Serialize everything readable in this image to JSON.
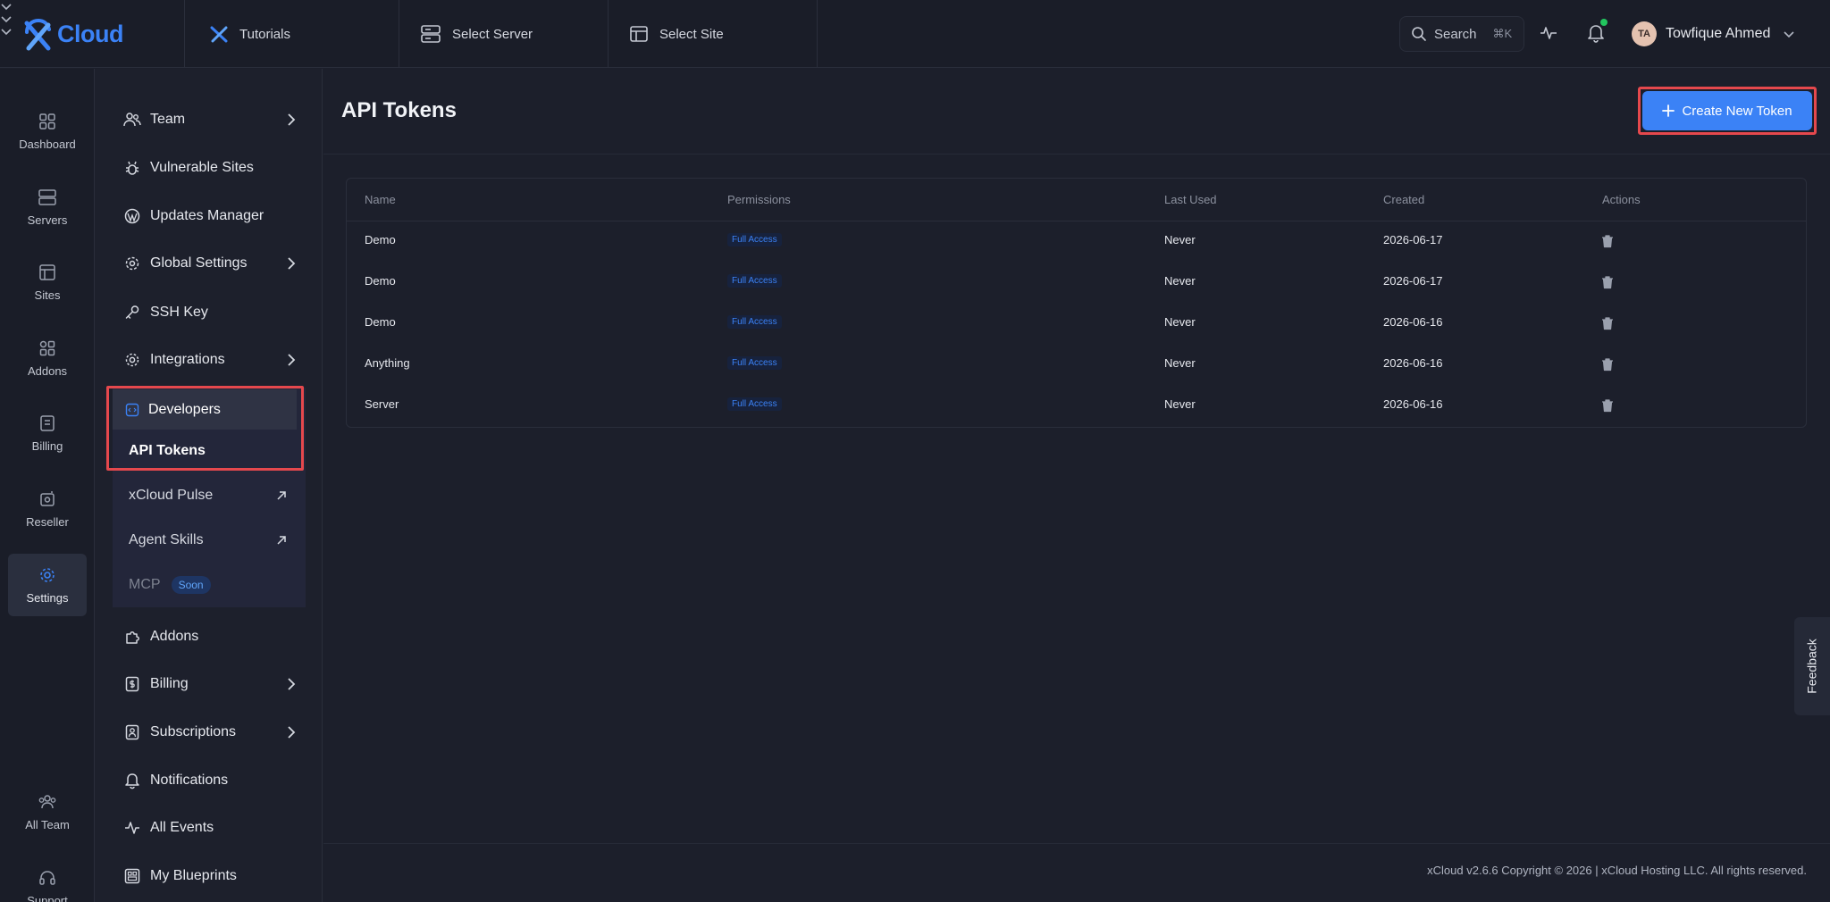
{
  "brand": {
    "name": "Cloud",
    "accent": "#3b82f6"
  },
  "topbar": {
    "selectors": [
      {
        "label": "Tutorials",
        "icon": "xcloud-icon"
      },
      {
        "label": "Select Server",
        "icon": "server-icon"
      },
      {
        "label": "Select Site",
        "icon": "site-icon"
      }
    ],
    "search": {
      "label": "Search",
      "shortcut": "⌘K"
    },
    "user": {
      "initials": "TA",
      "name": "Towfique Ahmed"
    }
  },
  "rail": {
    "items": [
      {
        "label": "Dashboard",
        "icon": "dashboard-icon"
      },
      {
        "label": "Servers",
        "icon": "server-icon"
      },
      {
        "label": "Sites",
        "icon": "site-icon"
      },
      {
        "label": "Addons",
        "icon": "addons-icon"
      },
      {
        "label": "Billing",
        "icon": "billing-icon"
      },
      {
        "label": "Reseller",
        "icon": "reseller-icon"
      },
      {
        "label": "Settings",
        "icon": "gear-icon",
        "active": true
      },
      {
        "label": "All Team",
        "icon": "team-icon"
      },
      {
        "label": "Support",
        "icon": "headset-icon"
      }
    ]
  },
  "sidebar": {
    "items": [
      {
        "label": "Team",
        "icon": "team-icon",
        "chevron": true
      },
      {
        "label": "Vulnerable Sites",
        "icon": "bug-icon"
      },
      {
        "label": "Updates Manager",
        "icon": "wordpress-icon"
      },
      {
        "label": "Global Settings",
        "icon": "globe-gear-icon",
        "chevron": true
      },
      {
        "label": "SSH Key",
        "icon": "key-icon"
      },
      {
        "label": "Integrations",
        "icon": "gear-icon",
        "chevron": true
      },
      {
        "label": "Addons",
        "icon": "puzzle-icon"
      },
      {
        "label": "Billing",
        "icon": "billing-icon",
        "chevron": true
      },
      {
        "label": "Subscriptions",
        "icon": "subscription-icon",
        "chevron": true
      },
      {
        "label": "Notifications",
        "icon": "bell-icon"
      },
      {
        "label": "All Events",
        "icon": "pulse-icon"
      },
      {
        "label": "My Blueprints",
        "icon": "blueprint-icon"
      }
    ],
    "developers": {
      "label": "Developers",
      "children": [
        {
          "label": "API Tokens",
          "active": true
        },
        {
          "label": "xCloud Pulse",
          "external": true
        },
        {
          "label": "Agent Skills",
          "external": true
        },
        {
          "label": "MCP",
          "badge": "Soon",
          "disabled": true
        }
      ]
    }
  },
  "main": {
    "title": "API Tokens",
    "create_button": "Create New Token",
    "table": {
      "columns": [
        "Name",
        "Permissions",
        "Last Used",
        "Created",
        "Actions"
      ],
      "rows": [
        {
          "name": "Demo",
          "permission": "Full Access",
          "last_used": "Never",
          "created": "2026-06-17"
        },
        {
          "name": "Demo",
          "permission": "Full Access",
          "last_used": "Never",
          "created": "2026-06-17"
        },
        {
          "name": "Demo",
          "permission": "Full Access",
          "last_used": "Never",
          "created": "2026-06-16"
        },
        {
          "name": "Anything",
          "permission": "Full Access",
          "last_used": "Never",
          "created": "2026-06-16"
        },
        {
          "name": "Server",
          "permission": "Full Access",
          "last_used": "Never",
          "created": "2026-06-16"
        }
      ]
    }
  },
  "footer": {
    "text": "xCloud v2.6.6 Copyright © 2026 | xCloud Hosting LLC. All rights reserved."
  },
  "feedback_tab": "Feedback"
}
